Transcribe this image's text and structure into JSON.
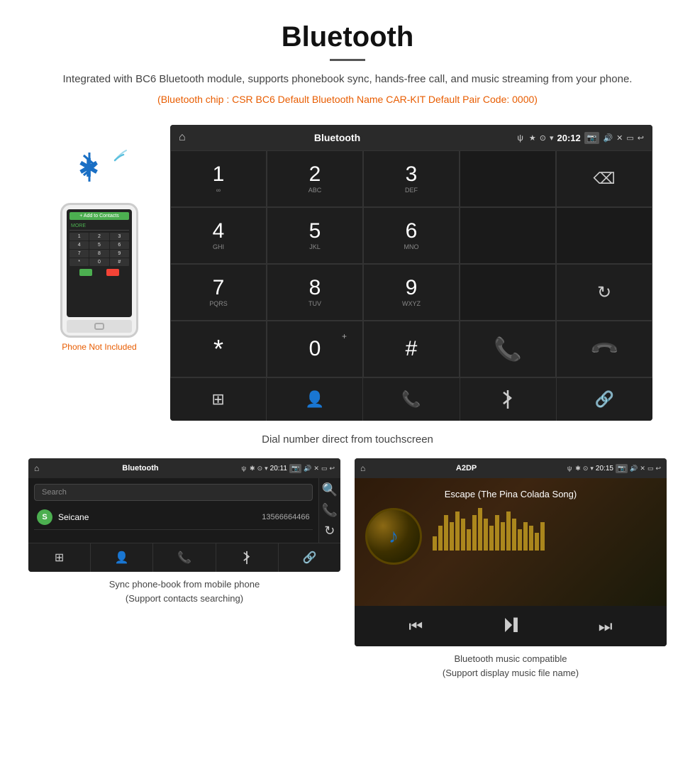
{
  "header": {
    "title": "Bluetooth",
    "description": "Integrated with BC6 Bluetooth module, supports phonebook sync, hands-free call, and music streaming from your phone.",
    "specs": "(Bluetooth chip : CSR BC6    Default Bluetooth Name CAR-KIT    Default Pair Code: 0000)"
  },
  "phone_illustration": {
    "not_included": "Phone Not Included"
  },
  "dial_screen": {
    "status_bar": {
      "title": "Bluetooth",
      "usb": "ψ",
      "time": "20:12"
    },
    "keys": [
      {
        "number": "1",
        "letters": "∞",
        "col": 1,
        "row": 1
      },
      {
        "number": "2",
        "letters": "ABC",
        "col": 2,
        "row": 1
      },
      {
        "number": "3",
        "letters": "DEF",
        "col": 3,
        "row": 1
      },
      {
        "number": "4",
        "letters": "GHI",
        "col": 1,
        "row": 2
      },
      {
        "number": "5",
        "letters": "JKL",
        "col": 2,
        "row": 2
      },
      {
        "number": "6",
        "letters": "MNO",
        "col": 3,
        "row": 2
      },
      {
        "number": "7",
        "letters": "PQRS",
        "col": 1,
        "row": 3
      },
      {
        "number": "8",
        "letters": "TUV",
        "col": 2,
        "row": 3
      },
      {
        "number": "9",
        "letters": "WXYZ",
        "col": 3,
        "row": 3
      },
      {
        "number": "*",
        "letters": "",
        "col": 1,
        "row": 4
      },
      {
        "number": "0",
        "letters": "+",
        "col": 2,
        "row": 4
      },
      {
        "number": "#",
        "letters": "",
        "col": 3,
        "row": 4
      }
    ],
    "bottom_nav": [
      "⊞",
      "👤",
      "📞",
      "✱",
      "🔗"
    ],
    "bottom_nav_names": [
      "apps",
      "contacts",
      "phone",
      "bluetooth",
      "link"
    ]
  },
  "main_caption": "Dial number direct from touchscreen",
  "phonebook_screen": {
    "status_bar": {
      "title": "Bluetooth",
      "time": "20:11"
    },
    "search_placeholder": "Search",
    "contacts": [
      {
        "letter": "S",
        "name": "Seicane",
        "number": "13566664466"
      }
    ]
  },
  "phonebook_caption": "Sync phone-book from mobile phone\n(Support contacts searching)",
  "music_screen": {
    "status_bar": {
      "title": "A2DP",
      "time": "20:15"
    },
    "song_title": "Escape (The Pina Colada Song)",
    "eq_heights": [
      20,
      35,
      50,
      40,
      55,
      45,
      30,
      50,
      60,
      45,
      35,
      50,
      40,
      55,
      45,
      30,
      40,
      35,
      25,
      40
    ]
  },
  "music_caption": "Bluetooth music compatible\n(Support display music file name)"
}
